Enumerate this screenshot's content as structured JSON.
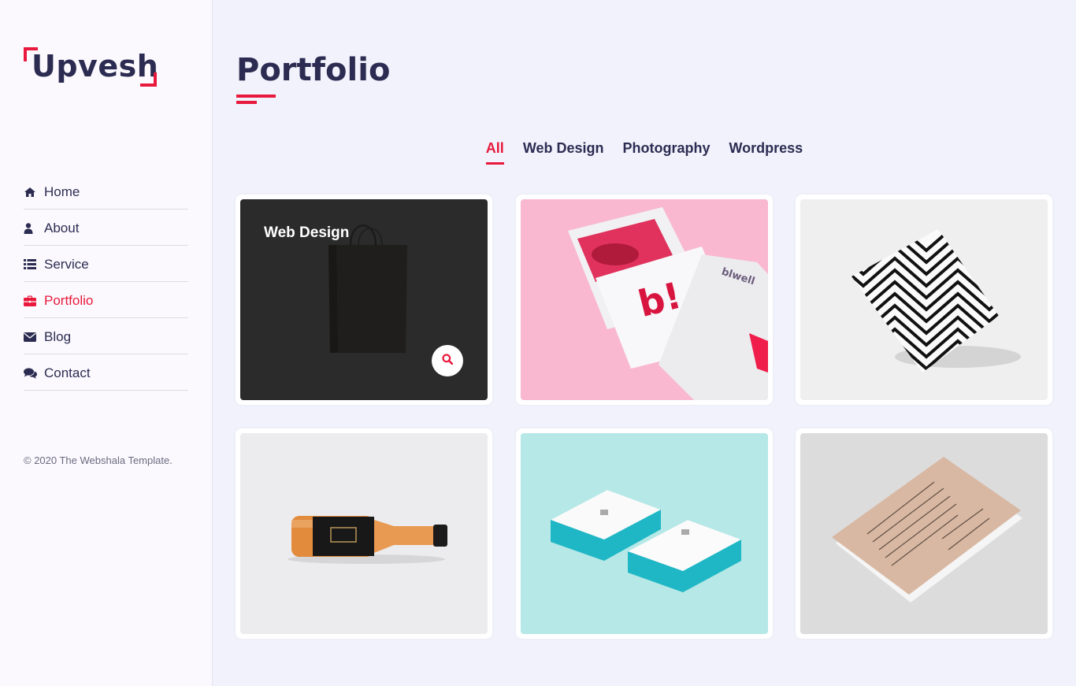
{
  "brand": {
    "logo_text": "Upvesh"
  },
  "nav": {
    "items": [
      {
        "label": "Home",
        "icon": "home-icon"
      },
      {
        "label": "About",
        "icon": "user-icon"
      },
      {
        "label": "Service",
        "icon": "list-icon"
      },
      {
        "label": "Portfolio",
        "icon": "briefcase-icon"
      },
      {
        "label": "Blog",
        "icon": "envelope-icon"
      },
      {
        "label": "Contact",
        "icon": "comments-icon"
      }
    ]
  },
  "copyright": "© 2020 The Webshala Template.",
  "main": {
    "title": "Portfolio",
    "filters": [
      "All",
      "Web Design",
      "Photography",
      "Wordpress"
    ]
  },
  "portfolio": {
    "hover_card_label": "Web Design"
  },
  "colors": {
    "accent": "#e8193c",
    "text": "#2c2c52",
    "background": "#f1f2fb",
    "sidebar": "#fbf9fd"
  }
}
